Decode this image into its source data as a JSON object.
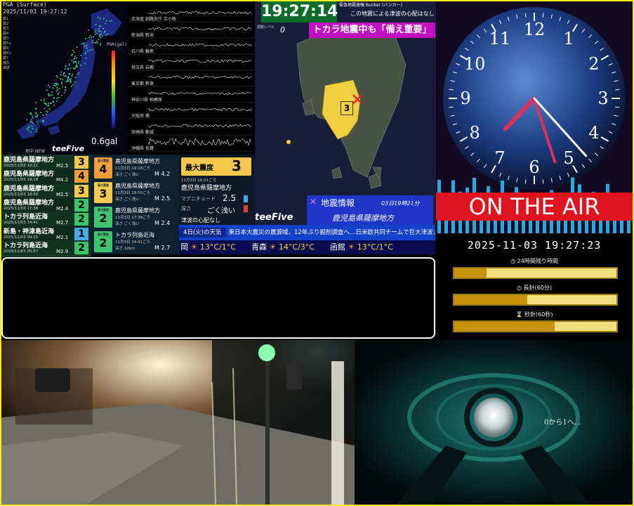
{
  "pga": {
    "title": "PGA (Surface)",
    "timestamp": "2025/11/03 19:27:12",
    "legend": [
      "震1",
      "震2",
      "震3",
      "震4",
      "震5-",
      "震5+",
      "震6-",
      "震6+",
      "震7",
      "揺れ",
      "津波"
    ],
    "scale_label": "PGA(gal)",
    "value": "0.6gal",
    "logo": "teeFive",
    "footer": "地中 NEW"
  },
  "waveforms": [
    "北海道 釧路支庁 苫小牧",
    "新潟県 新潟",
    "石川県 輪島",
    "埼玉県 岩槻",
    "東京都 新宿",
    "神奈川県 相模原",
    "大阪府 堺",
    "宮崎県 都城",
    "沖縄県 名護"
  ],
  "quake_list": [
    {
      "name": "鹿児島県薩摩地方",
      "date": "2025/11/03 19:21",
      "mag": "M2.5",
      "intensity": "3",
      "color": "#f2c94c"
    },
    {
      "name": "鹿児島県薩摩地方",
      "date": "2025/11/03 19:18",
      "mag": "M4.2",
      "intensity": "4",
      "color": "#f29d3c"
    },
    {
      "name": "鹿児島県薩摩地方",
      "date": "2025/11/03 18:50",
      "mag": "M2.5",
      "intensity": "3",
      "color": "#f2c94c"
    },
    {
      "name": "鹿児島県薩摩地方",
      "date": "2025/11/03 17:38",
      "mag": "M2.4",
      "intensity": "2",
      "color": "#3ec46d"
    },
    {
      "name": "トカラ列島近海",
      "date": "2025/11/03 14:41",
      "mag": "M2.7",
      "intensity": "2",
      "color": "#3ec46d"
    },
    {
      "name": "新島・神津島近海",
      "date": "2025/11/03 09:15",
      "mag": "M2.1",
      "intensity": "1",
      "color": "#4aa8e8"
    },
    {
      "name": "トカラ列島近海",
      "date": "2025/11/03 05:57",
      "mag": "M2.9",
      "intensity": "2",
      "color": "#3ec46d"
    }
  ],
  "detail": [
    {
      "badge_label": "最大震度",
      "intensity": "4",
      "name": "鹿児島県薩摩地方",
      "time": "11月3日 19:18ごろ",
      "depth": "深さ ごく浅い",
      "mag": "M 4.2",
      "color": "#f29d3c"
    },
    {
      "badge_label": "最大震度",
      "intensity": "3",
      "name": "鹿児島県薩摩地方",
      "time": "11月3日 18:50ごろ",
      "depth": "深さ ごく浅い",
      "mag": "M 2.5",
      "color": "#f2c94c"
    },
    {
      "badge_label": "最大震度",
      "intensity": "2",
      "name": "鹿児島県薩摩地方",
      "time": "11月3日 17:38ごろ",
      "depth": "深さ ごく浅い",
      "mag": "M 2.4",
      "color": "#3ec46d"
    },
    {
      "badge_label": "最大震度",
      "intensity": "2",
      "name": "トカラ列島近海",
      "time": "11月3日 14:41ごろ",
      "depth": "深さ 10km",
      "mag": "M 2.7",
      "color": "#3ec46d"
    }
  ],
  "max_panel": {
    "label": "最大震度",
    "value": "3",
    "name": "鹿児島県薩摩地方",
    "time": "11月3日 19:21ごろ",
    "mag_label": "マグニチュード",
    "mag": "2.5",
    "depth_label": "深さ",
    "depth": "ごく浅い",
    "tsunami": "津波の心配なし",
    "logo": "teeFive"
  },
  "map": {
    "clock": "19:27:14",
    "top_note_1": "緊急地震速報 Bunker (バンカー)",
    "top_note_2": "この地震による津波の心配はなし",
    "level_label": "振動レベル",
    "level_value": "0",
    "banner": "トカラ地震中も「備え重要」",
    "epicenter_intensity": "3",
    "info_title": "地震情報",
    "info_time": "03日19時21分",
    "info_region": "鹿児島県薩摩地方",
    "info_color": "#1f35c8"
  },
  "ticker": {
    "label": "4日(火)の天気",
    "text": "東日本大震災の震源域、12年ぶり掘削調査へ…日米欧共同チームで巨大津波メカニズム解明目指す"
  },
  "weather": [
    {
      "city": "岡",
      "icon": "sun-cloud-icon",
      "temp": "13°C/1°C"
    },
    {
      "city": "青森",
      "icon": "sun-cloud-icon",
      "temp": "14°C/3°C"
    },
    {
      "city": "函館",
      "icon": "sun-cloud-icon",
      "temp": "13°C/1°C"
    }
  ],
  "earth_clock": {
    "numbers": [
      "12",
      "1",
      "2",
      "3",
      "4",
      "5",
      "6",
      "7",
      "8",
      "9",
      "10",
      "11"
    ],
    "on_air": "ON THE AIR",
    "hour": 7,
    "minute": 27,
    "second": 23
  },
  "datetime": "2025-11-03 19:27:23",
  "progress": [
    {
      "icon": "clock-icon",
      "label": "24時間残り時間",
      "fraction": 0.2
    },
    {
      "icon": "clock-icon",
      "label": "長針(60分)",
      "fraction": 0.45
    },
    {
      "icon": "hourglass-icon",
      "label": "秒針(60秒)",
      "fraction": 0.62
    }
  ],
  "cam2_text": "0から1へ…",
  "colors": {
    "frame": "#f5ec18",
    "banner": "#c010c0",
    "clock_bg": "#0b6d2a",
    "ticker": "#1540c8",
    "epicenter": "#e02020",
    "land": "#f0d040"
  }
}
